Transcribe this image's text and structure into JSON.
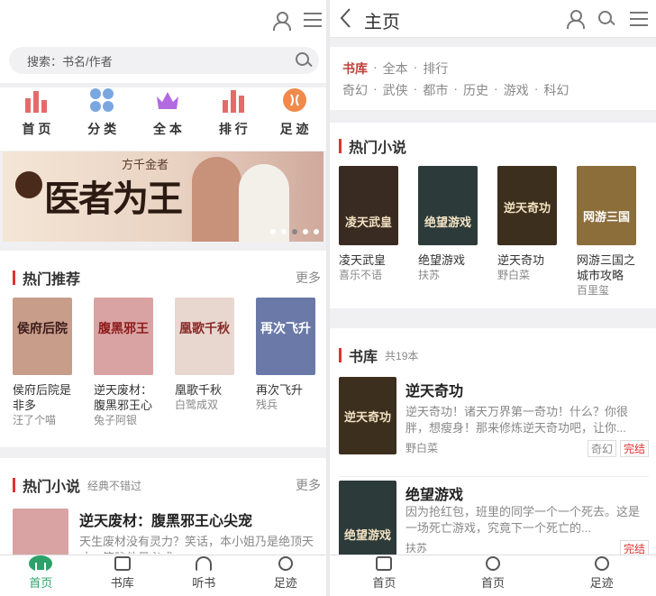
{
  "left": {
    "search": {
      "placeholder": "搜索：书名/作者"
    },
    "nav": [
      {
        "label": "首 页",
        "icon": "bar-chart-icon",
        "color": "#e56a6a"
      },
      {
        "label": "分 类",
        "icon": "grid-dots-icon",
        "color": "#7aa7e0"
      },
      {
        "label": "全 本",
        "icon": "crown-icon",
        "color": "#b26ae0"
      },
      {
        "label": "排 行",
        "icon": "ranking-icon",
        "color": "#e56a6a"
      },
      {
        "label": "足 迹",
        "icon": "footprint-icon",
        "color": "#f08a4b"
      }
    ],
    "banner": {
      "subtitle": "方千金者",
      "title": "医者为王"
    },
    "hot_recommend": {
      "title": "热门推荐",
      "more": "更多",
      "books": [
        {
          "name": "侯府后院是非多",
          "author": "汪了个喵",
          "cover_text": "侯府后院",
          "color": "#c89d8a"
        },
        {
          "name": "逆天废材：腹黑邪王心",
          "author": "兔子阿银",
          "cover_text": "腹黑邪王",
          "color": "#d9a3a3"
        },
        {
          "name": "凰歌千秋",
          "author": "白鹭成双",
          "cover_text": "凰歌千秋",
          "color": "#e8d7cf"
        },
        {
          "name": "再次飞升",
          "author": "残兵",
          "cover_text": "再次飞升",
          "color": "#6a79a8"
        }
      ]
    },
    "hot_novel": {
      "title": "热门小说",
      "subtitle": "经典不错过",
      "more": "更多",
      "book_title": "逆天废材：腹黑邪王心尖宠",
      "desc": "天生废材没有灵力？笑话，本小姐乃是绝顶天才，筋脉他日必成..."
    },
    "tabbar": [
      {
        "label": "首页",
        "icon": "home-icon"
      },
      {
        "label": "书库",
        "icon": "book-icon"
      },
      {
        "label": "听书",
        "icon": "headphones-icon"
      },
      {
        "label": "足迹",
        "icon": "history-icon"
      }
    ]
  },
  "right": {
    "title": "主页",
    "library_links": [
      "书库",
      "全本",
      "排行"
    ],
    "genre_links": [
      "奇幻",
      "武侠",
      "都市",
      "历史",
      "游戏",
      "科幻"
    ],
    "hot_novel": {
      "title": "热门小说",
      "books": [
        {
          "name": "凌天武皇",
          "author": "喜乐不语",
          "cover_text": "凌天武皇",
          "color": "#3a2b22"
        },
        {
          "name": "绝望游戏",
          "author": "扶苏",
          "cover_text": "绝望游戏",
          "color": "#2c3a3a"
        },
        {
          "name": "逆天奇功",
          "author": "野白菜",
          "cover_text": "逆天奇功",
          "color": "#3d2f1e"
        },
        {
          "name": "网游三国之城市攻略",
          "author": "百里玺",
          "cover_text": "网游三国",
          "color": "#8c6e3b"
        }
      ]
    },
    "library": {
      "title": "书库",
      "count": "共19本",
      "items": [
        {
          "name": "逆天奇功",
          "desc": "逆天奇功！诸天万界第一奇功！什么？你很胖，想瘦身！那来修炼逆天奇功吧，让你...",
          "author": "野白菜",
          "tags": [
            "奇幻",
            "完结"
          ],
          "cover_text": "逆天奇功",
          "color": "#3d2f1e"
        },
        {
          "name": "绝望游戏",
          "desc": "因为抢红包，班里的同学一个一个死去。这是一场死亡游戏，究竟下一个死亡的...",
          "author": "扶苏",
          "tags": [
            "完结"
          ],
          "cover_text": "绝望游戏",
          "color": "#2c3a3a"
        }
      ]
    },
    "tabbar": [
      {
        "label": "首页",
        "icon": "home-icon"
      },
      {
        "label": "首页",
        "icon": "history-icon"
      },
      {
        "label": "足迹",
        "icon": "history-icon"
      }
    ]
  }
}
